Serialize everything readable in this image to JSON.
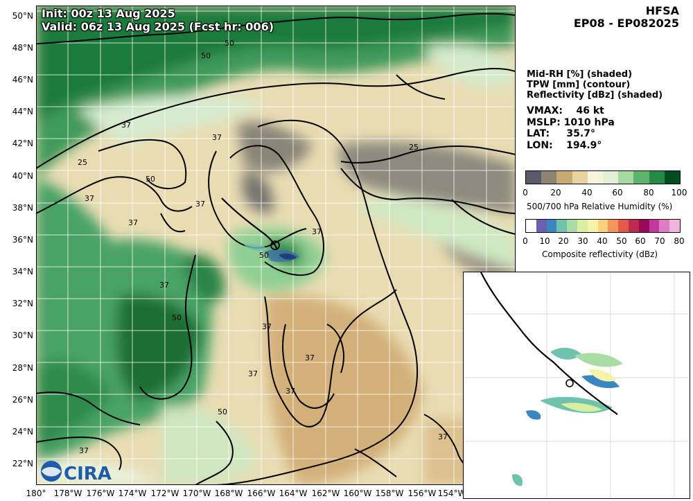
{
  "header": {
    "model": "HFSA",
    "storm": "EP08 - EP082025"
  },
  "map_title": {
    "init": "Init:   00z 13 Aug 2025",
    "valid": "Valid: 06z 13 Aug 2025 (Fcst hr: 006)"
  },
  "legend_text": {
    "line1": "Mid-RH [%] (shaded)",
    "line2": "TPW [mm] (contour)",
    "line3": "Reflectivity [dBz] (shaded)"
  },
  "stats": {
    "vmax": "VMAX:    46 kt",
    "mslp": "MSLP: 1010 hPa",
    "lat": "LAT:     35.7°",
    "lon": "LON:    194.9°"
  },
  "lat_labels": [
    "50°N",
    "48°N",
    "46°N",
    "44°N",
    "42°N",
    "40°N",
    "38°N",
    "36°N",
    "34°N",
    "32°N",
    "30°N",
    "28°N",
    "26°N",
    "24°N",
    "22°N"
  ],
  "lon_labels": [
    "180°",
    "178°W",
    "176°W",
    "174°W",
    "172°W",
    "170°W",
    "168°W",
    "166°W",
    "164°W",
    "162°W",
    "160°W",
    "158°W",
    "156°W",
    "154°W"
  ],
  "contour_labels": [
    "50",
    "50",
    "37",
    "25",
    "37",
    "50",
    "37",
    "37",
    "37",
    "37",
    "50",
    "50",
    "37",
    "37",
    "37",
    "37",
    "50",
    "37",
    "25",
    "37",
    "37"
  ],
  "rh_colorbar": {
    "ticks": [
      "0",
      "20",
      "40",
      "60",
      "80",
      "100"
    ],
    "title": "500/700 hPa Relative Humidity (%)",
    "colors": [
      "#5a5a6a",
      "#8c8575",
      "#c7aa72",
      "#e6d3a0",
      "#f8f3de",
      "#e2f1d6",
      "#a9d8a0",
      "#5fb46d",
      "#228b45",
      "#004d1f"
    ]
  },
  "refl_colorbar": {
    "ticks": [
      "0",
      "10",
      "20",
      "30",
      "40",
      "50",
      "60",
      "70",
      "80"
    ],
    "title": "Composite reflectivity (dBz)",
    "colors": [
      "#ffffff",
      "#6a5fb0",
      "#3a86c0",
      "#6fc3ad",
      "#a9dba4",
      "#d8efa0",
      "#f5f3a8",
      "#fcd07c",
      "#f7945c",
      "#e45a4a",
      "#c02a4c",
      "#9b0a5a",
      "#c2389e",
      "#e07cc0",
      "#f2b4dc"
    ]
  },
  "logo": "CIRA"
}
